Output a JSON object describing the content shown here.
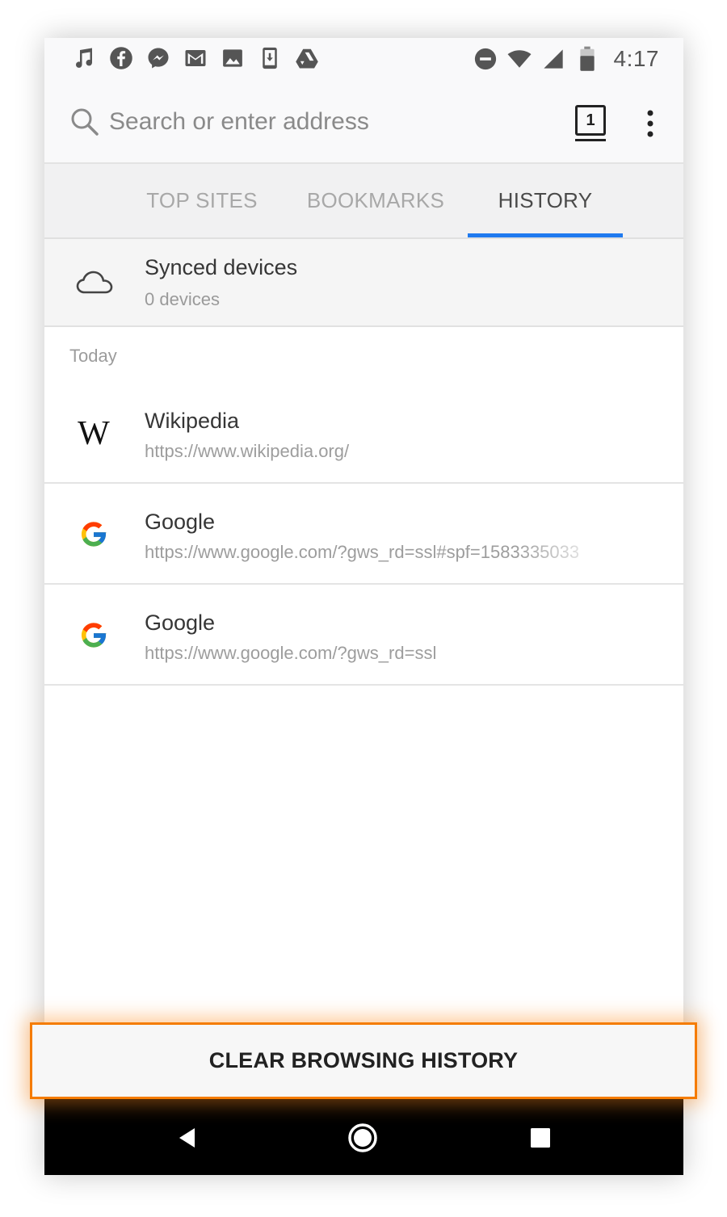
{
  "status_bar": {
    "time": "4:17",
    "notification_icons": [
      "music-note-icon",
      "facebook-icon",
      "messenger-icon",
      "gmail-icon",
      "image-icon",
      "download-icon",
      "google-drive-icon"
    ],
    "system_icons": [
      "do-not-disturb-icon",
      "wifi-icon",
      "cellular-signal-icon",
      "battery-icon"
    ]
  },
  "toolbar": {
    "search_placeholder": "Search or enter address",
    "tab_count": "1"
  },
  "panel_tabs": [
    {
      "label": "TOP SITES",
      "active": false
    },
    {
      "label": "BOOKMARKS",
      "active": false
    },
    {
      "label": "HISTORY",
      "active": true
    }
  ],
  "synced": {
    "title": "Synced devices",
    "subtitle": "0 devices"
  },
  "history": {
    "section_label": "Today",
    "items": [
      {
        "title": "Wikipedia",
        "url": "https://www.wikipedia.org/",
        "icon": "wikipedia-icon"
      },
      {
        "title": "Google",
        "url": "https://www.google.com/?gws_rd=ssl#spf=1583335033",
        "icon": "google-icon"
      },
      {
        "title": "Google",
        "url": "https://www.google.com/?gws_rd=ssl",
        "icon": "google-icon"
      }
    ]
  },
  "clear_button": {
    "label": "CLEAR BROWSING HISTORY",
    "highlight_color": "#f57c00"
  },
  "colors": {
    "accent": "#1f7aef",
    "highlight": "#f57c00"
  }
}
